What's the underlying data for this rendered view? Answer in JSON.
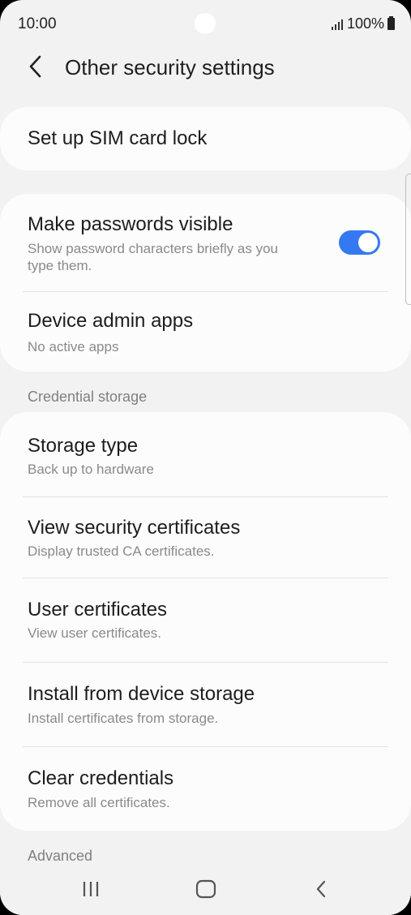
{
  "status_bar": {
    "time": "10:00",
    "battery": "100%",
    "icons": [
      "signal-icon",
      "battery-icon"
    ]
  },
  "header": {
    "title": "Other security settings",
    "back_icon": "chevron-left-icon"
  },
  "items": {
    "sim_lock": {
      "title": "Set up SIM card lock"
    },
    "passwords_visible": {
      "title": "Make passwords visible",
      "subtitle_1": "Show password characters briefly as you",
      "subtitle_2": "type them.",
      "toggle_on": true
    },
    "device_admin": {
      "title": "Device admin apps",
      "subtitle": "No active apps"
    },
    "storage_type": {
      "title": "Storage type",
      "subtitle": "Back up to hardware"
    },
    "view_certs": {
      "title": "View security certificates",
      "subtitle": "Display trusted CA certificates."
    },
    "user_certs": {
      "title": "User certificates",
      "subtitle": "View user certificates."
    },
    "install_storage": {
      "title": "Install from device storage",
      "subtitle": "Install certificates from storage."
    },
    "clear_creds": {
      "title": "Clear credentials",
      "subtitle": "Remove all certificates."
    }
  },
  "sections": {
    "credential_storage": "Credential storage",
    "advanced": "Advanced"
  },
  "nav_bar": {
    "icons": [
      "recent-apps-icon",
      "home-icon",
      "back-icon"
    ]
  },
  "colors": {
    "accent": "#3479f2",
    "background": "#f2f2f2",
    "card": "#fcfcfc"
  }
}
